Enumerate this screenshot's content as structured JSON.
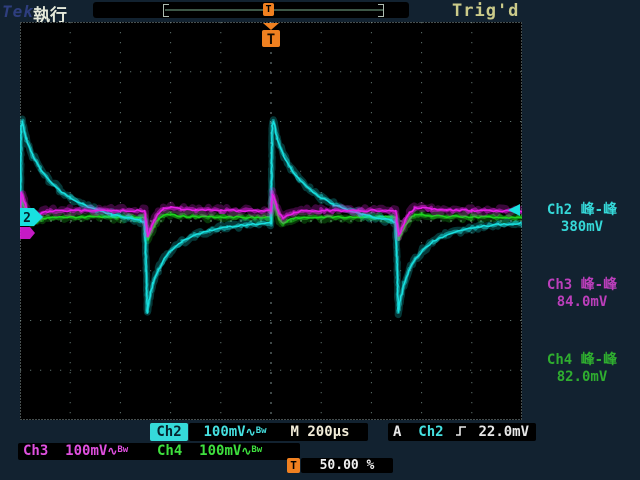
{
  "header": {
    "logo": "Tek",
    "acq_status": "執行",
    "trigger_status": "Trig'd",
    "record_trigger_icon": "T"
  },
  "trigger_flag_label": "T",
  "channel_marker_ch2": "2",
  "measurements": [
    {
      "channel": "Ch2",
      "type": "峰-峰",
      "value": "380mV",
      "color": "#35d8d8"
    },
    {
      "channel": "Ch3",
      "type": "峰-峰",
      "value": "84.0mV",
      "color": "#bb3fbb"
    },
    {
      "channel": "Ch4",
      "type": "峰-峰",
      "value": "82.0mV",
      "color": "#2fae2f"
    }
  ],
  "readouts": {
    "ch2": {
      "label": "Ch2",
      "scale": "100mV",
      "coupling": "∿",
      "bandwidth": "Bw"
    },
    "ch3": {
      "label": "Ch3",
      "scale": "100mV",
      "coupling": "∿",
      "bandwidth": "Bw"
    },
    "ch4": {
      "label": "Ch4",
      "scale": "100mV",
      "coupling": "∿",
      "bandwidth": "Bw"
    },
    "timebase": {
      "label": "M",
      "value": "200µs"
    },
    "trigger": {
      "mode": "A",
      "source": "Ch2",
      "slope": "rising",
      "level": "22.0mV"
    },
    "trigger_position": {
      "icon": "T",
      "value": "50.00 %"
    }
  },
  "colors": {
    "ch2": "#18e0e0",
    "ch3": "#e81ee8",
    "ch4": "#1ed41e",
    "grid": "#5c6e6a",
    "grid_center": "#7d8f8f",
    "border": "#8c9c9c",
    "trigger_orange": "#f08020"
  },
  "chart_data": {
    "type": "line",
    "title": "Oscilloscope acquisition: 1 kHz square-wave transient response",
    "x_unit": "µs",
    "y_unit": "mV",
    "time_per_div_us": 200,
    "volts_per_div_mV": 100,
    "divisions": {
      "x": 10,
      "y": 8
    },
    "window_us": [
      -1000,
      1000
    ],
    "trigger_time_us": 0,
    "trigger_level_mV": 22.0,
    "edge_times_us": [
      -1000,
      0
    ],
    "series": [
      {
        "name": "Ch4",
        "color": "#1ed41e",
        "peak_to_peak_mV": 82.0,
        "period_points": [
          [
            0,
            6
          ],
          [
            6,
            45
          ],
          [
            18,
            26
          ],
          [
            32,
            4
          ],
          [
            48,
            -4
          ],
          [
            65,
            0
          ],
          [
            90,
            5
          ],
          [
            120,
            7
          ],
          [
            200,
            8
          ],
          [
            350,
            8
          ],
          [
            480,
            8
          ],
          [
            497,
            7
          ],
          [
            503,
            -15
          ],
          [
            509,
            -37
          ],
          [
            520,
            -24
          ],
          [
            535,
            -8
          ],
          [
            552,
            4
          ],
          [
            572,
            12
          ],
          [
            600,
            13
          ],
          [
            640,
            10
          ],
          [
            700,
            9
          ],
          [
            800,
            8
          ],
          [
            997,
            7
          ]
        ]
      },
      {
        "name": "Ch2",
        "color": "#18e0e0",
        "peak_to_peak_mV": 380,
        "period_points": [
          [
            0,
            -5
          ],
          [
            5,
            190
          ],
          [
            10,
            200
          ],
          [
            25,
            165
          ],
          [
            50,
            132
          ],
          [
            80,
            105
          ],
          [
            115,
            82
          ],
          [
            155,
            63
          ],
          [
            200,
            47
          ],
          [
            250,
            33
          ],
          [
            305,
            22
          ],
          [
            365,
            13
          ],
          [
            430,
            6
          ],
          [
            480,
            1
          ],
          [
            497,
            -2
          ],
          [
            503,
            -100
          ],
          [
            507,
            -183
          ],
          [
            515,
            -158
          ],
          [
            530,
            -126
          ],
          [
            550,
            -99
          ],
          [
            575,
            -76
          ],
          [
            605,
            -58
          ],
          [
            645,
            -42
          ],
          [
            695,
            -29
          ],
          [
            755,
            -19
          ],
          [
            825,
            -12
          ],
          [
            905,
            -7
          ],
          [
            997,
            -4
          ]
        ]
      },
      {
        "name": "Ch3",
        "color": "#e81ee8",
        "peak_to_peak_mV": 84.0,
        "period_points": [
          [
            0,
            20
          ],
          [
            6,
            55
          ],
          [
            18,
            38
          ],
          [
            32,
            16
          ],
          [
            48,
            6
          ],
          [
            65,
            10
          ],
          [
            90,
            17
          ],
          [
            120,
            20
          ],
          [
            200,
            21
          ],
          [
            350,
            21
          ],
          [
            480,
            21
          ],
          [
            497,
            20
          ],
          [
            503,
            -5
          ],
          [
            509,
            -29
          ],
          [
            520,
            -16
          ],
          [
            535,
            2
          ],
          [
            552,
            16
          ],
          [
            572,
            26
          ],
          [
            600,
            27
          ],
          [
            640,
            24
          ],
          [
            700,
            22
          ],
          [
            800,
            21
          ],
          [
            997,
            20
          ]
        ]
      }
    ]
  }
}
